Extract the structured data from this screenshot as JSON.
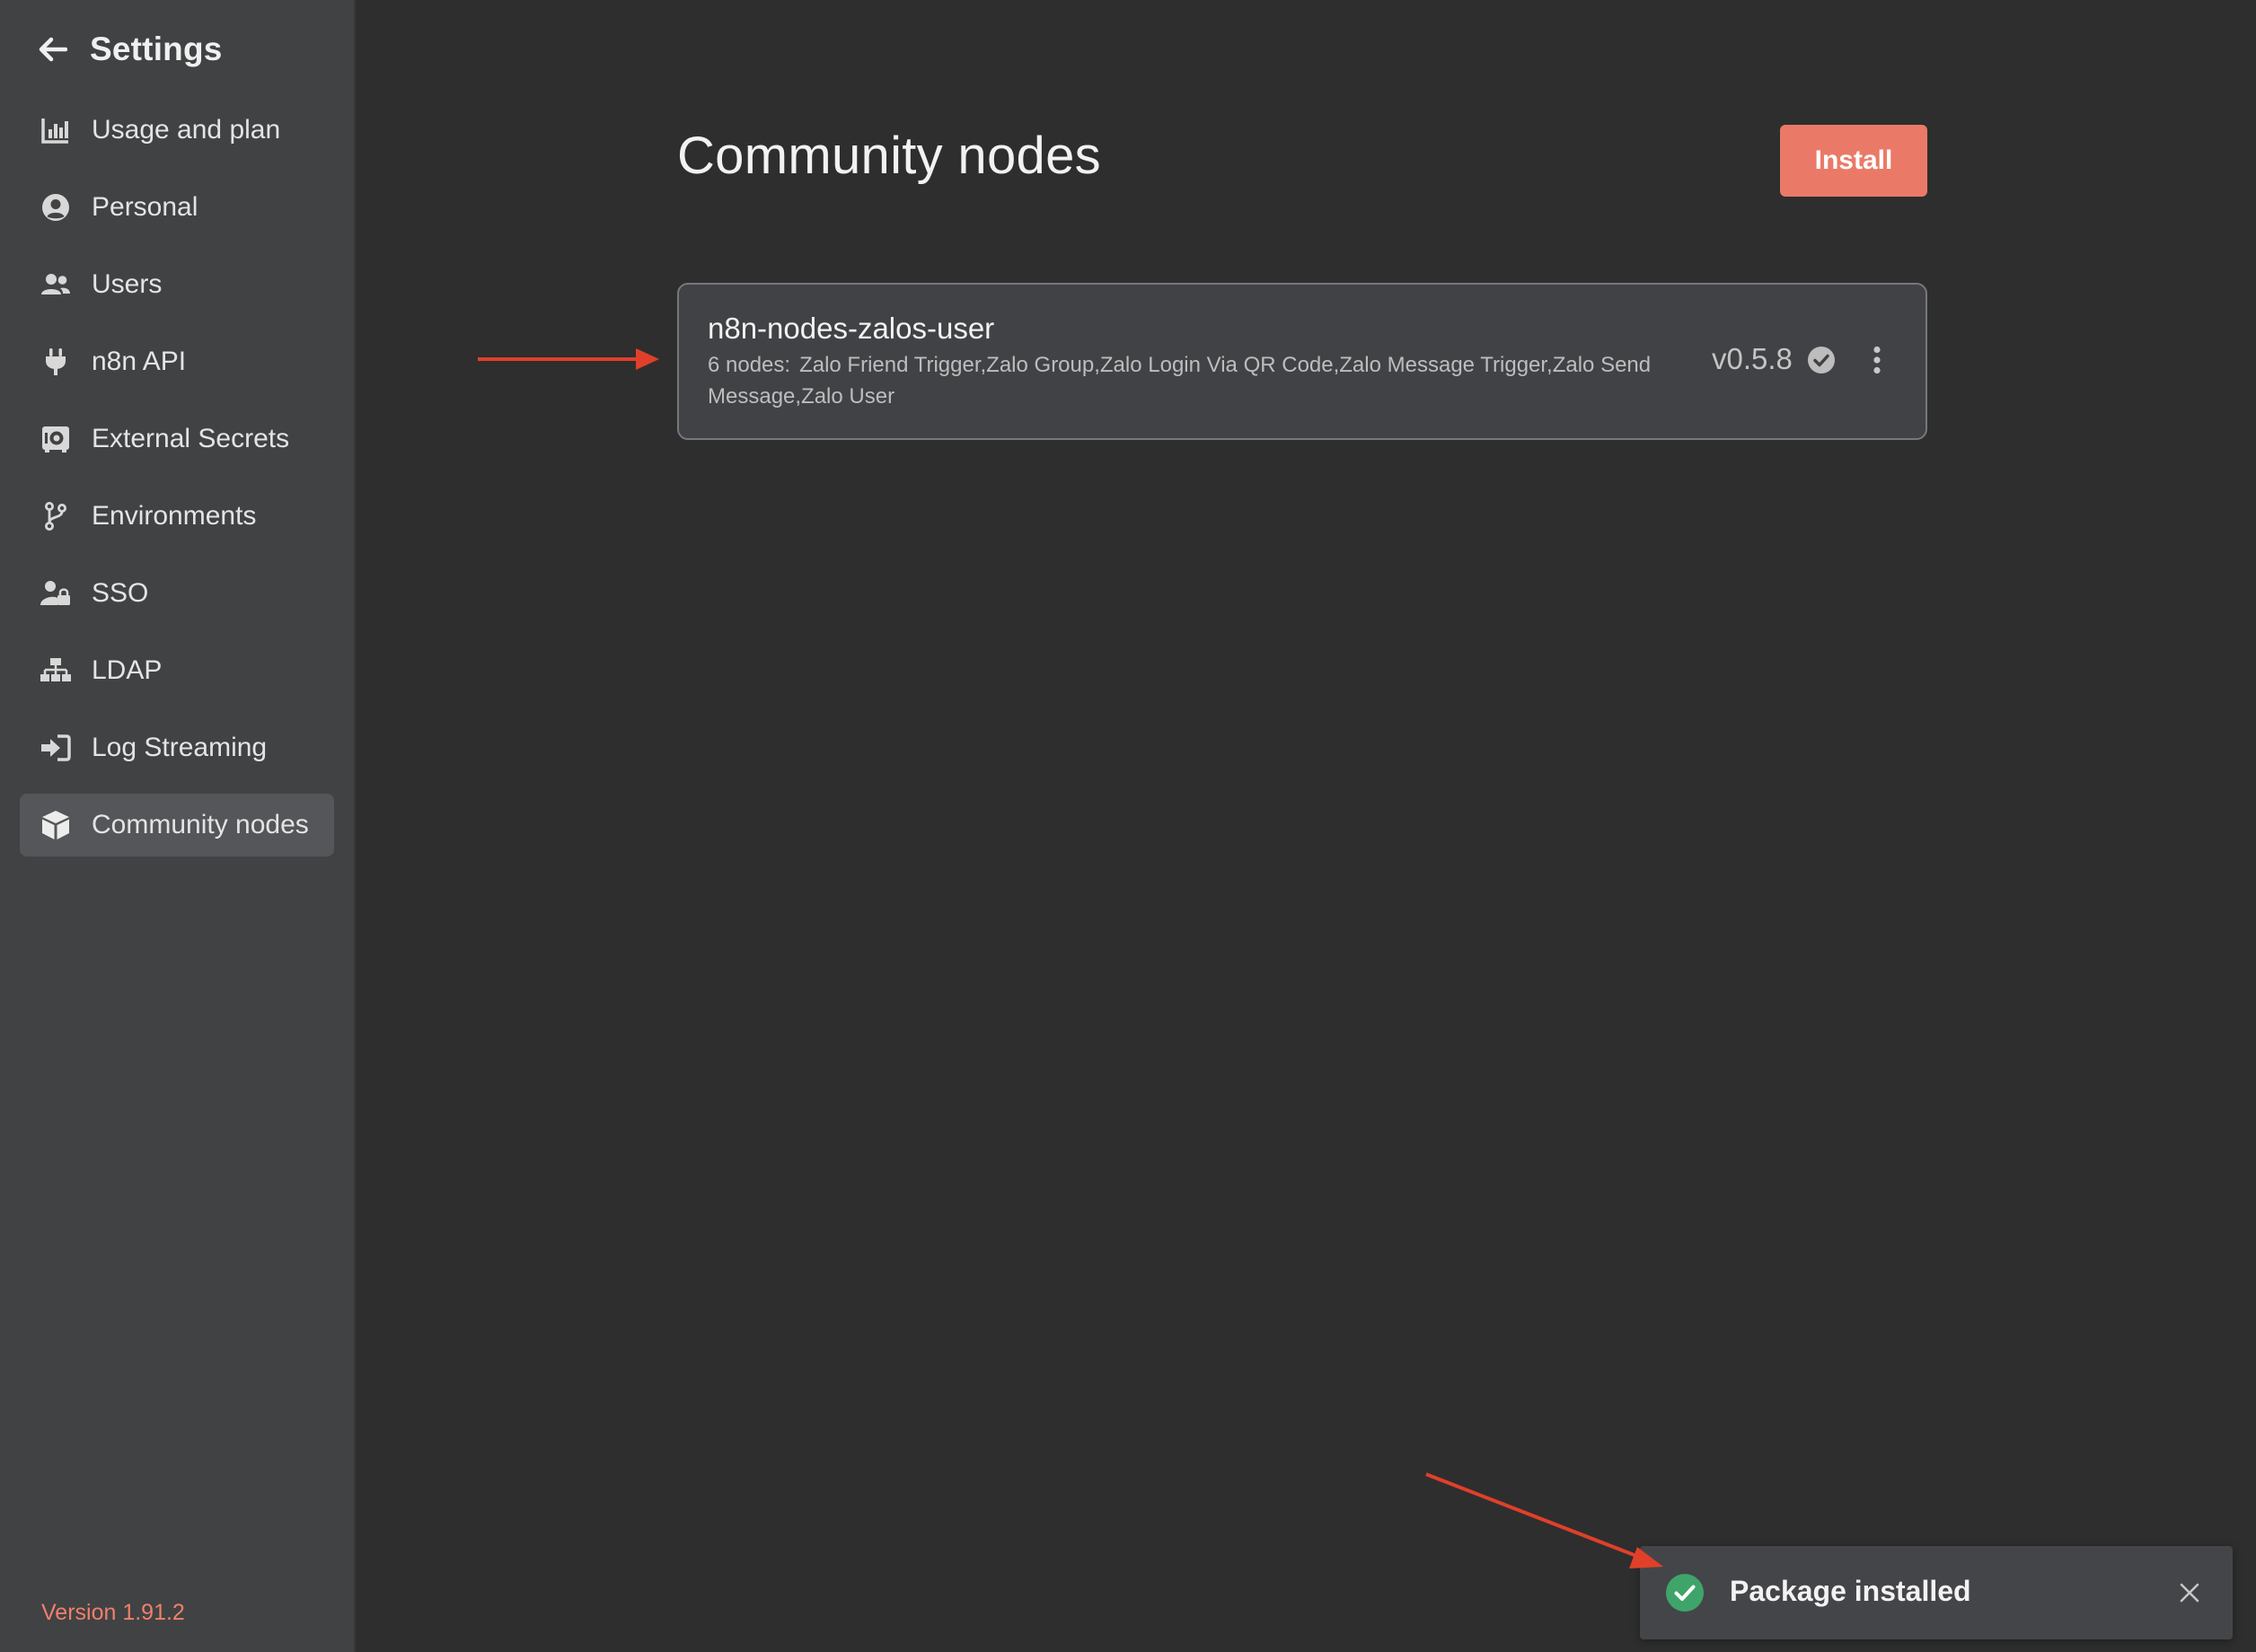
{
  "sidebar": {
    "title": "Settings",
    "items": [
      {
        "label": "Usage and plan",
        "icon": "chart-bar-icon"
      },
      {
        "label": "Personal",
        "icon": "user-circle-icon"
      },
      {
        "label": "Users",
        "icon": "users-icon"
      },
      {
        "label": "n8n API",
        "icon": "plug-icon"
      },
      {
        "label": "External Secrets",
        "icon": "vault-icon"
      },
      {
        "label": "Environments",
        "icon": "git-branch-icon"
      },
      {
        "label": "SSO",
        "icon": "user-lock-icon"
      },
      {
        "label": "LDAP",
        "icon": "network-wired-icon"
      },
      {
        "label": "Log Streaming",
        "icon": "sign-in-icon"
      },
      {
        "label": "Community nodes",
        "icon": "cube-icon",
        "active": true
      }
    ],
    "version": "Version 1.91.2"
  },
  "main": {
    "title": "Community nodes",
    "install_label": "Install",
    "packages": [
      {
        "name": "n8n-nodes-zalos-user",
        "nodes_count": "6 nodes:",
        "nodes_list": "Zalo Friend Trigger,Zalo Group,Zalo Login Via QR Code,Zalo Message Trigger,Zalo Send Message,Zalo User",
        "version": "v0.5.8"
      }
    ]
  },
  "toast": {
    "message": "Package installed"
  },
  "colors": {
    "accent": "#ea7a67",
    "version_text": "#f0806b",
    "success": "#3fa46a",
    "annotation_arrow": "#e0402a"
  }
}
